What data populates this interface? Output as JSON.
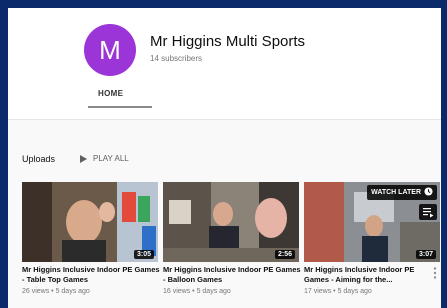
{
  "channel": {
    "avatar_letter": "M",
    "avatar_color": "#9b35d8",
    "name": "Mr Higgins Multi Sports",
    "subscribers": "14 subscribers"
  },
  "tabs": [
    {
      "label": "HOME",
      "active": true
    }
  ],
  "uploads": {
    "title": "Uploads",
    "play_all_label": "PLAY ALL",
    "videos": [
      {
        "title": "Mr Higgins Inclusive Indoor PE Games - Table Top Games",
        "meta": "26 views • 5 days ago",
        "duration": "3:05"
      },
      {
        "title": "Mr Higgins Inclusive Indoor PE Games - Balloon Games",
        "meta": "16 views • 5 days ago",
        "duration": "2:56"
      },
      {
        "title": "Mr Higgins Inclusive Indoor PE Games - Aiming for the...",
        "meta": "17 views • 5 days ago",
        "duration": "3:07",
        "watch_later_label": "WATCH LATER"
      }
    ]
  }
}
